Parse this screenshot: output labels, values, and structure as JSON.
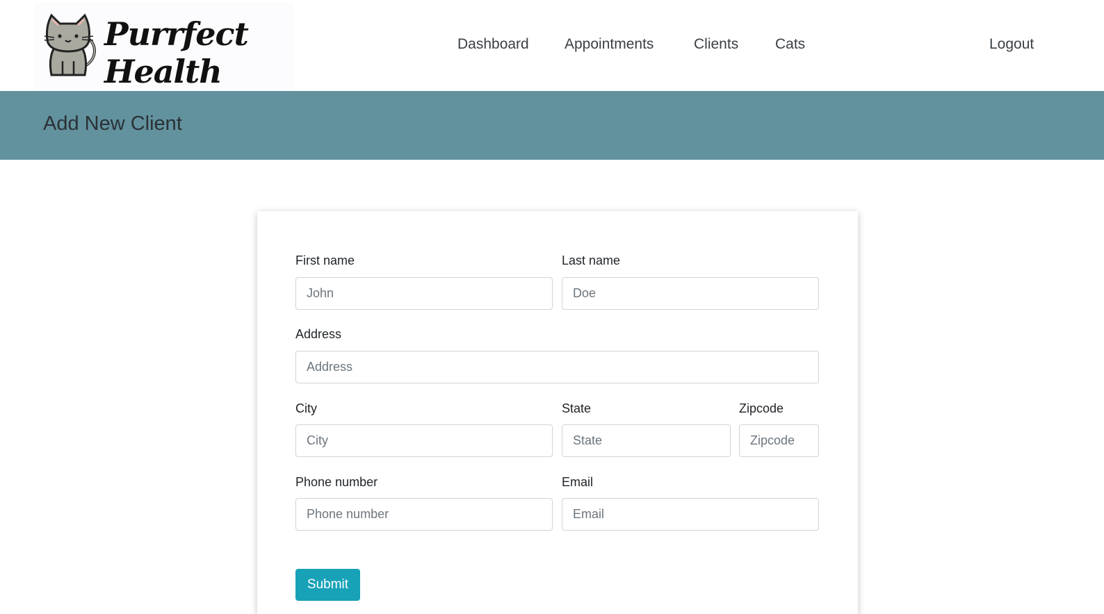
{
  "brand": {
    "name": "Purrfect Health"
  },
  "nav": {
    "dashboard": "Dashboard",
    "appointments": "Appointments",
    "clients": "Clients",
    "cats": "Cats",
    "logout": "Logout"
  },
  "page": {
    "title": "Add New Client"
  },
  "form": {
    "first_name": {
      "label": "First name",
      "placeholder": "John",
      "value": ""
    },
    "last_name": {
      "label": "Last name",
      "placeholder": "Doe",
      "value": ""
    },
    "address": {
      "label": "Address",
      "placeholder": "Address",
      "value": ""
    },
    "city": {
      "label": "City",
      "placeholder": "City",
      "value": ""
    },
    "state": {
      "label": "State",
      "placeholder": "State",
      "value": ""
    },
    "zipcode": {
      "label": "Zipcode",
      "placeholder": "Zipcode",
      "value": ""
    },
    "phone": {
      "label": "Phone number",
      "placeholder": "Phone number",
      "value": ""
    },
    "email": {
      "label": "Email",
      "placeholder": "Email",
      "value": ""
    },
    "submit_label": "Submit"
  },
  "colors": {
    "banner": "#62929e",
    "submit": "#17a2b8",
    "nav_text": "#3a3f44"
  },
  "icons": {
    "logo": "cat-icon"
  }
}
